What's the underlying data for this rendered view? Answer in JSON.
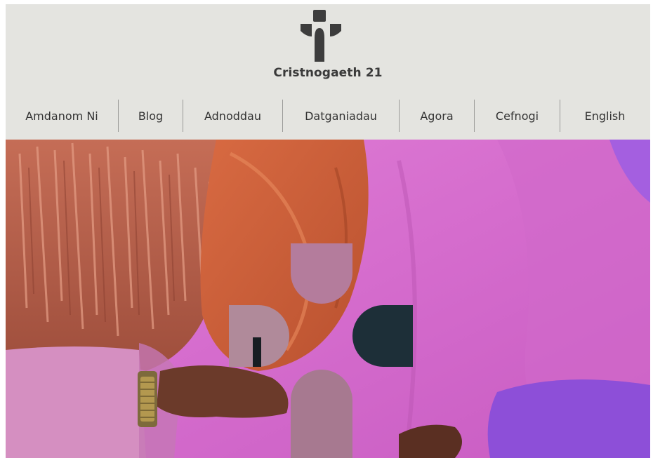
{
  "header": {
    "site_title": "Cristnogaeth 21",
    "logo_icon": "cross-logo-icon",
    "logo_color": "#3d3d3d",
    "background": "#e4e4e0"
  },
  "nav": {
    "items": [
      {
        "label": "Amdanom Ni"
      },
      {
        "label": "Blog"
      },
      {
        "label": "Adnoddau"
      },
      {
        "label": "Datganiadau"
      },
      {
        "label": "Agora"
      },
      {
        "label": "Cefnogi"
      },
      {
        "label": "English"
      }
    ]
  },
  "hero": {
    "colors": {
      "fringe_jacket": "#b9614a",
      "hood": "#cc5d38",
      "fleece": "#d772cc",
      "sleeve_purple": "#8d4fd8",
      "glyph_mauve": "#b47c9c",
      "glyph_dark": "#1d2f38"
    }
  }
}
